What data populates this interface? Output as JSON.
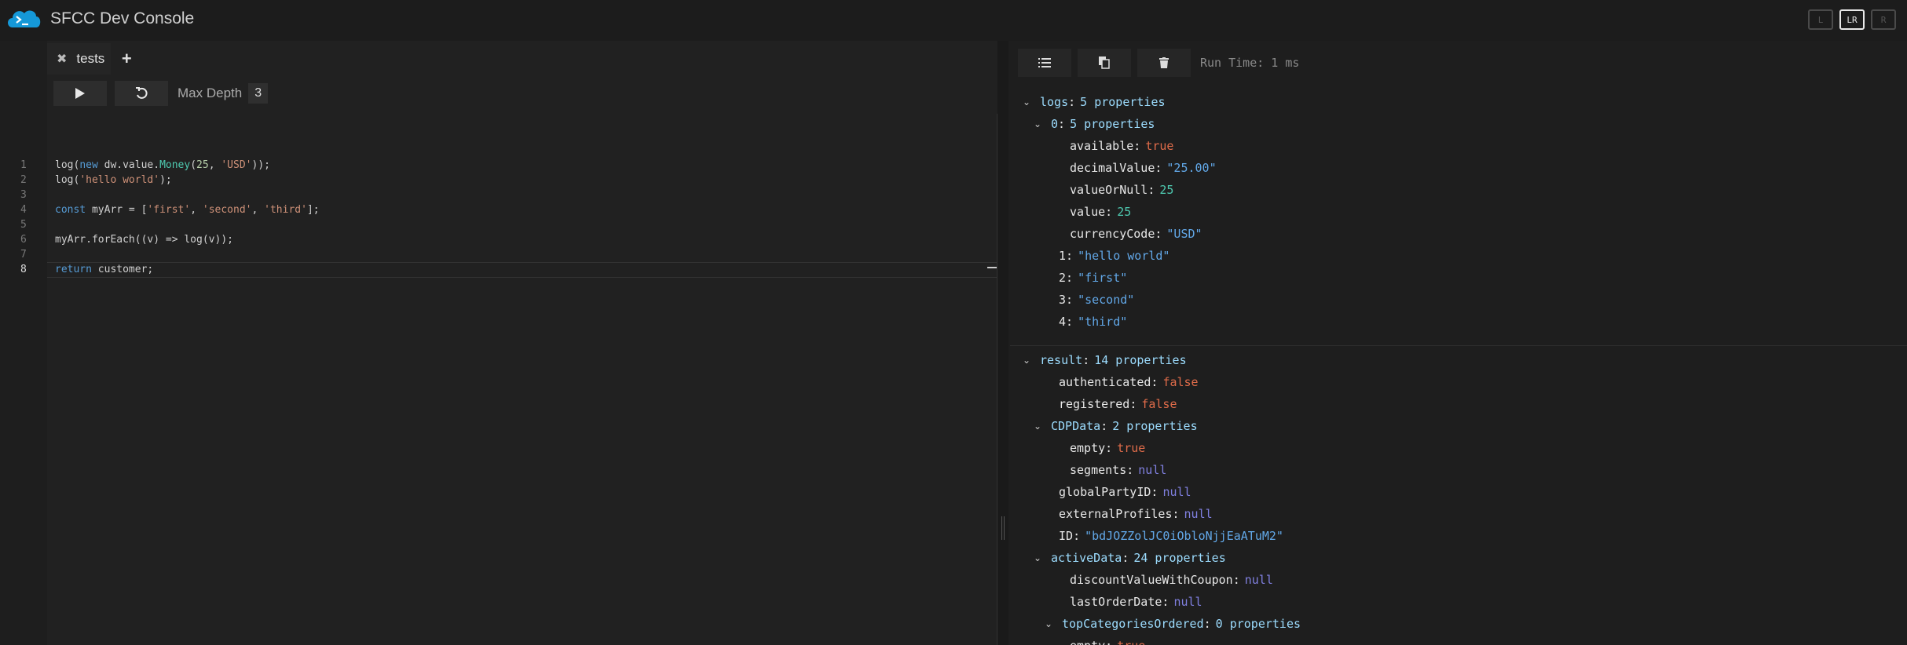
{
  "header": {
    "title": "SFCC Dev Console",
    "layout_buttons": [
      "L",
      "LR",
      "R"
    ]
  },
  "editor": {
    "tab_label": "tests",
    "max_depth_label": "Max Depth",
    "max_depth_value": "3",
    "line_numbers": [
      "1",
      "2",
      "3",
      "4",
      "5",
      "6",
      "7",
      "8"
    ]
  },
  "output": {
    "run_time": "Run Time: 1 ms",
    "logs": {
      "key": "logs",
      "desc": "5 properties",
      "item0": {
        "key": "0",
        "desc": "5 properties",
        "available": "true",
        "decimalValue": "\"25.00\"",
        "valueOrNull": "25",
        "value": "25",
        "currencyCode": "\"USD\""
      },
      "item1": "\"hello world\"",
      "item2": "\"first\"",
      "item3": "\"second\"",
      "item4": "\"third\""
    },
    "result": {
      "key": "result",
      "desc": "14 properties",
      "authenticated": "false",
      "registered": "false",
      "CDPData_desc": "2 properties",
      "CDPData_empty": "true",
      "CDPData_segments": "null",
      "globalPartyID": "null",
      "externalProfiles": "null",
      "ID": "\"bdJOZZolJC0iObloNjjEaATuM2\"",
      "activeData_desc": "24 properties",
      "discountValueWithCoupon": "null",
      "lastOrderDate": "null",
      "topCategoriesOrdered_desc": "0 properties",
      "topCategoriesOrdered_empty": "true"
    }
  }
}
